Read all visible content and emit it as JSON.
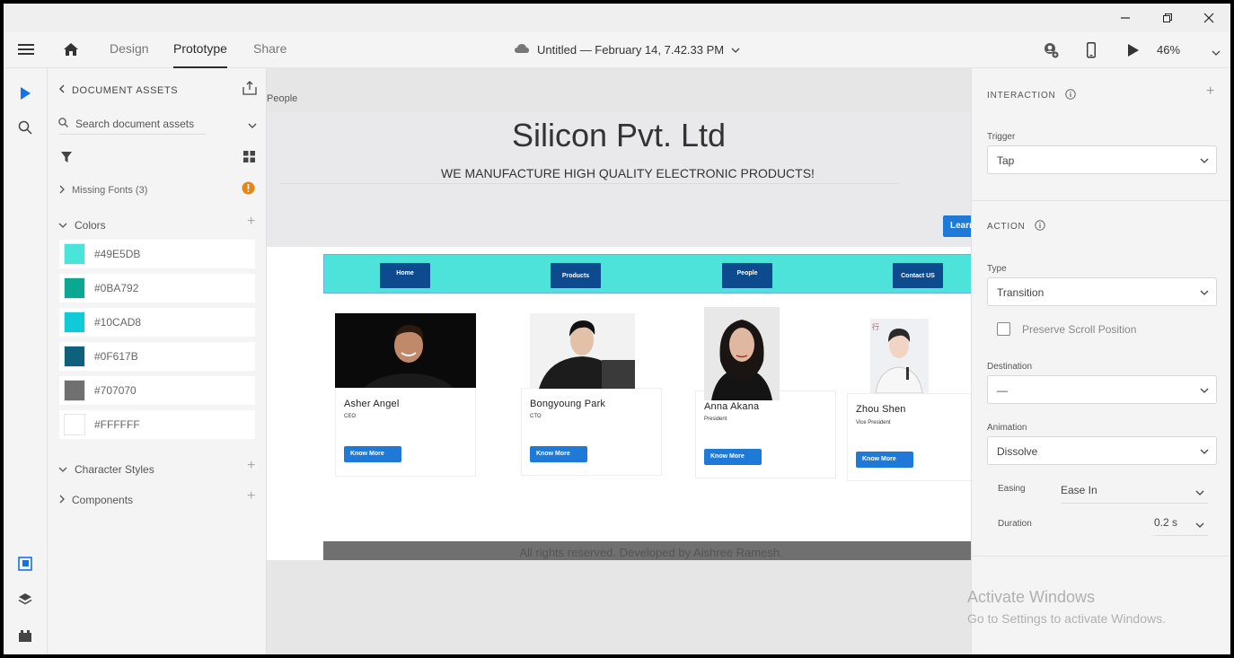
{
  "window": {
    "controls": [
      "minimize-icon",
      "restore-icon",
      "close-icon"
    ]
  },
  "appbar": {
    "tabs": [
      {
        "label": "Design"
      },
      {
        "label": "Prototype"
      },
      {
        "label": "Share"
      }
    ],
    "doc_title": "Untitled — February 14, 7.42.33 PM",
    "zoom": "46%"
  },
  "assets": {
    "header": "DOCUMENT ASSETS",
    "search_placeholder": "Search document assets",
    "missing_fonts": "Missing Fonts (3)",
    "colors_label": "Colors",
    "colors": [
      {
        "hex": "#49E5DB"
      },
      {
        "hex": "#0BA792"
      },
      {
        "hex": "#10CAD8"
      },
      {
        "hex": "#0F617B"
      },
      {
        "hex": "#707070"
      },
      {
        "hex": "#FFFFFF"
      }
    ],
    "character_styles": "Character Styles",
    "components": "Components"
  },
  "canvas": {
    "artboard_label": "People",
    "site_title": "Silicon Pvt. Ltd",
    "site_subtitle": "WE MANUFACTURE HIGH QUALITY ELECTRONIC PRODUCTS!",
    "learn_button": "Learn",
    "nav": [
      "Home",
      "Products",
      "People",
      "Contact US"
    ],
    "people": [
      {
        "name": "Asher Angel",
        "role": "CEO",
        "button": "Know More"
      },
      {
        "name": "Bongyoung Park",
        "role": "CTO",
        "button": "Know More"
      },
      {
        "name": "Anna Akana",
        "role": "President",
        "button": "Know More"
      },
      {
        "name": "Zhou Shen",
        "role": "Vice President",
        "button": "Know More"
      }
    ],
    "footer": "All rights reserved. Developed by Aishree Ramesh."
  },
  "interaction": {
    "title": "INTERACTION",
    "trigger_label": "Trigger",
    "trigger_value": "Tap",
    "action_title": "ACTION",
    "type_label": "Type",
    "type_value": "Transition",
    "preserve_scroll": "Preserve Scroll Position",
    "destination_label": "Destination",
    "destination_value": "—",
    "animation_label": "Animation",
    "animation_value": "Dissolve",
    "easing_label": "Easing",
    "easing_value": "Ease In",
    "duration_label": "Duration",
    "duration_value": "0.2 s"
  },
  "watermark": {
    "line1": "Activate Windows",
    "line2": "Go to Settings to activate Windows."
  }
}
